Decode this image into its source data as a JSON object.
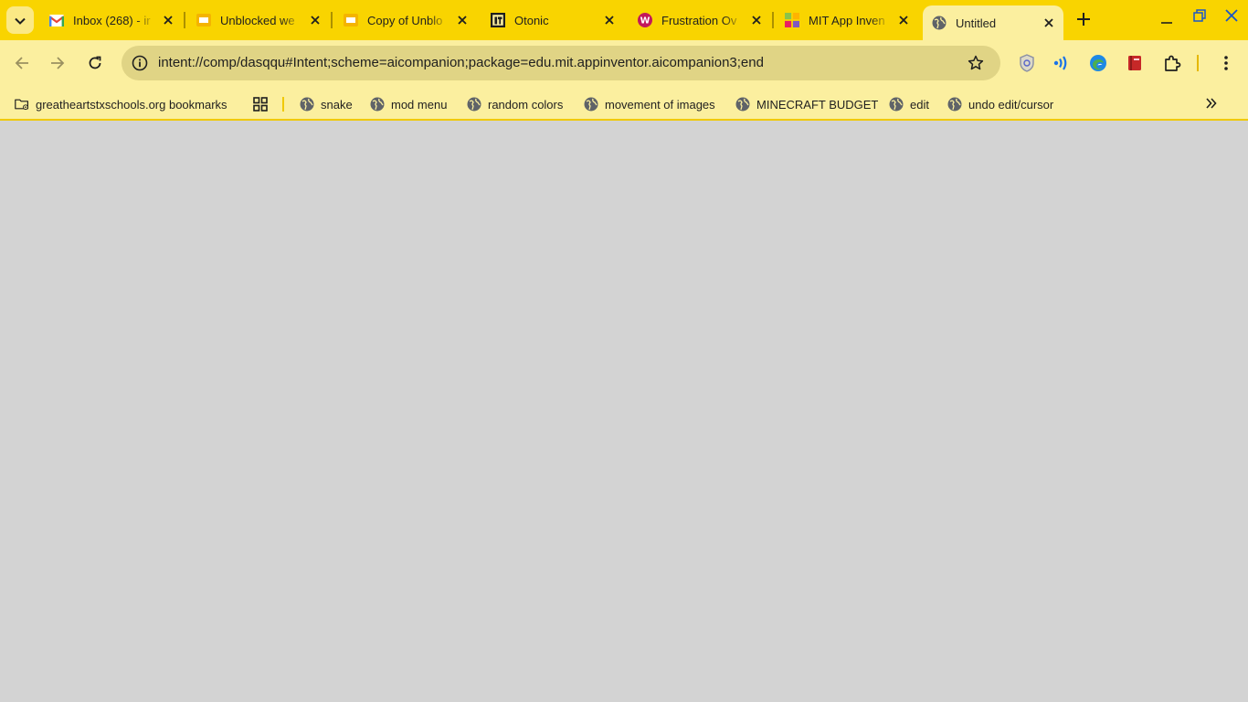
{
  "tabs": [
    {
      "title": "Inbox (268) - ir",
      "icon": "gmail-icon"
    },
    {
      "title": "Unblocked we",
      "icon": "slides-icon"
    },
    {
      "title": "Copy of Unblo",
      "icon": "slides-icon"
    },
    {
      "title": "Otonic",
      "icon": "otonic-icon"
    },
    {
      "title": "Frustration Ov",
      "icon": "w-logo-icon"
    },
    {
      "title": "MIT App Inven",
      "icon": "appinventor-icon"
    },
    {
      "title": "Untitled",
      "icon": "globe-icon",
      "active": true
    }
  ],
  "address_bar": {
    "url": "intent://comp/dasqqu#Intent;scheme=aicompanion;package=edu.mit.appinventor.aicompanion3;end"
  },
  "bookmarks": {
    "folder": "greatheartstxschools.org bookmarks",
    "items": [
      "snake",
      "mod menu",
      "random colors",
      "movement of images",
      "MINECRAFT BUDGET",
      "edit",
      "undo edit/cursor"
    ]
  },
  "colors": {
    "frame": "#f9d400",
    "toolbar": "#fbef9f",
    "omnibox": "#e0d485",
    "page": "#d3d3d3"
  }
}
